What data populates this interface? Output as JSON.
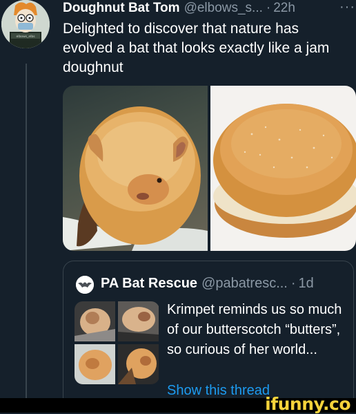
{
  "tweet": {
    "author_name": "Doughnut Bat Tom",
    "handle": "@elbows_s...",
    "separator": "·",
    "time": "22h",
    "more_icon": "ellipsis-icon",
    "text": "Delighted to discover that nature has evolved a bat that looks exactly like a jam doughnut",
    "avatar_label": "elbows_elbs"
  },
  "quoted_tweet": {
    "author_name": "PA Bat Rescue",
    "handle": "@pabatresc...",
    "separator": "·",
    "time": "1d",
    "text": "Krimpet reminds us so much of our butterscotch “butters”, so curious of her world...",
    "show_thread_label": "Show this thread"
  },
  "watermark": {
    "text": "ifunny.co",
    "color": "#f5d33b"
  },
  "colors": {
    "background": "#15202b",
    "secondary_text": "#8b98a5",
    "link": "#1d9bf0",
    "border": "#38444d"
  }
}
